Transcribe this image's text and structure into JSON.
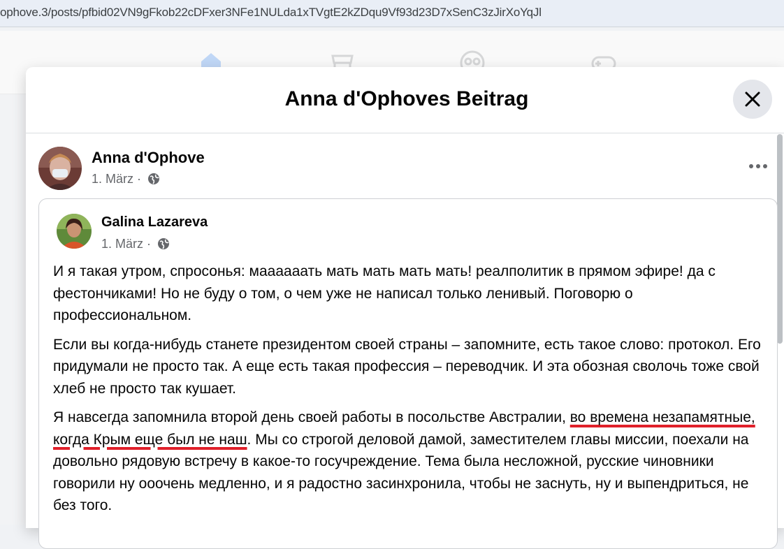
{
  "browser": {
    "url": "ophove.3/posts/pfbid02VN9gFkob22cDFxer3NFe1NULda1xTVgtE2kZDqu9Vf93d23D7xSenC3zJirXoYqJl"
  },
  "nav": {
    "icons": [
      "home-icon",
      "marketplace-icon",
      "groups-icon",
      "gaming-icon"
    ],
    "active_color": "#1877f2"
  },
  "dialog": {
    "title": "Anna d'Ophoves Beitrag",
    "close_icon": "close-icon"
  },
  "post": {
    "author": "Anna d'Ophove",
    "date": "1. März",
    "privacy_icon": "globe-icon",
    "more_icon": "more-options-icon",
    "shared": {
      "author": "Galina Lazareva",
      "date": "1. März",
      "paragraphs": {
        "p1": "И я такая утром, спросонья: маааааать мать мать мать мать! реалполитик в прямом эфире! да с фестончиками! Но не буду о том, о чем уже не написал только ленивый. Поговорю о профессиональном.",
        "p2": "Если вы когда-нибудь станете президентом своей страны – запомните, есть такое слово: протокол. Его придумали не просто так. А еще есть такая профессия – переводчик. И эта обозная сволочь тоже свой хлеб не просто так кушает.",
        "p3_start": "Я навсегда запомнила второй день своей работы в посольстве Австралии, ",
        "p3_underlined": "во времена незапамятные, когда Крым еще был не наш",
        "p3_end": ". Мы со строгой деловой дамой, заместителем главы миссии, поехали на довольно рядовую встречу в какое-то госучреждение. Тема была несложной, русские чиновники говорили ну ооочень медленно, и я радостно засинхронила, чтобы не заснуть, ну и выпендриться, не без того."
      }
    }
  }
}
